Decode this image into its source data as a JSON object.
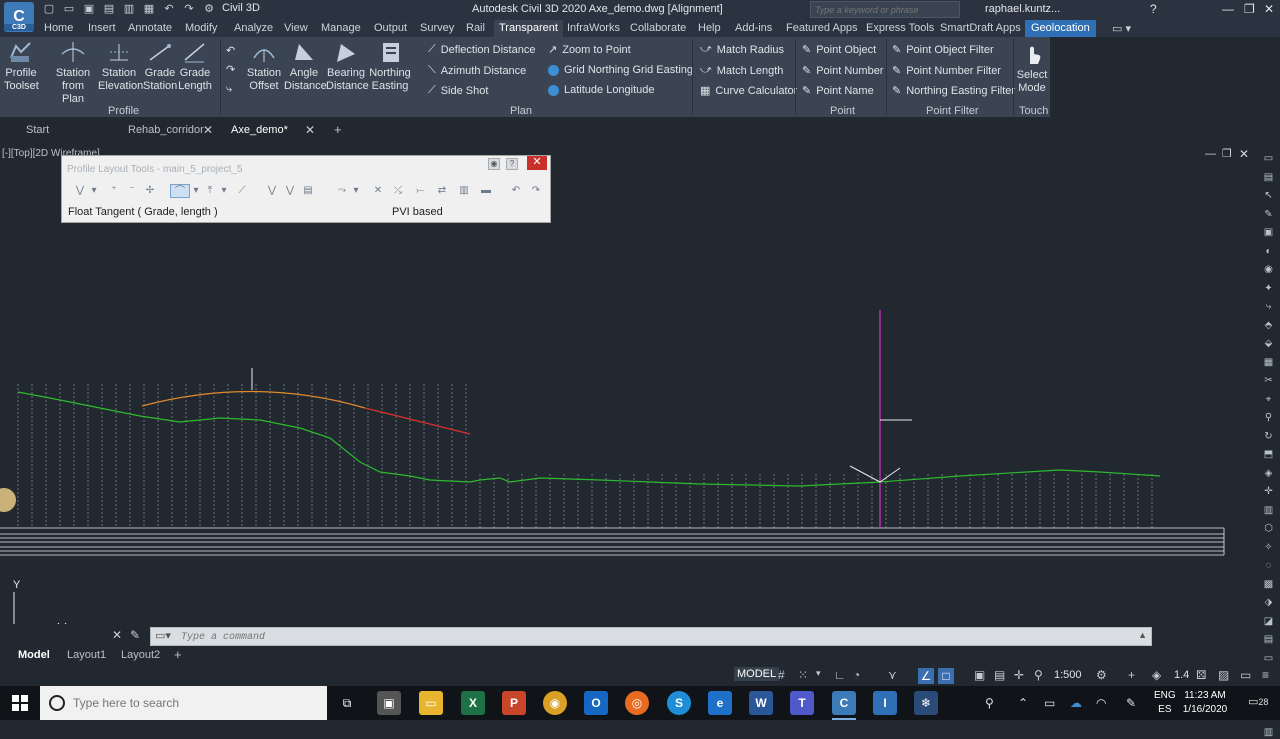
{
  "titlebar": {
    "workspace": "Civil 3D",
    "title": "Autodesk Civil 3D 2020   Axe_demo.dwg [Alignment]",
    "search_placeholder": "Type a keyword or phrase",
    "user": "raphael.kuntz...",
    "logo_text": "C",
    "logo_sub": "C3D"
  },
  "menu": [
    "Home",
    "Insert",
    "Annotate",
    "Modify",
    "Analyze",
    "View",
    "Manage",
    "Output",
    "Survey",
    "Rail",
    "Transparent",
    "InfraWorks",
    "Collaborate",
    "Help",
    "Add-ins",
    "Featured Apps",
    "Express Tools",
    "SmartDraft Apps",
    "Geolocation"
  ],
  "menu_active": "Transparent",
  "ribbon": {
    "profile_buttons": [
      {
        "l1": "Profile",
        "l2": "Toolset"
      },
      {
        "l1": "Station",
        "l2": "from Plan"
      },
      {
        "l1": "Station",
        "l2": "Elevation"
      },
      {
        "l1": "Grade",
        "l2": "Station"
      },
      {
        "l1": "Grade",
        "l2": "Length"
      }
    ],
    "plan_buttons": [
      {
        "l1": "Station",
        "l2": "Offset"
      },
      {
        "l1": "Angle",
        "l2": "Distance"
      },
      {
        "l1": "Bearing",
        "l2": "Distance"
      },
      {
        "l1": "Northing",
        "l2": "Easting"
      }
    ],
    "plan_small_a": [
      "Deflection Distance",
      "Azimuth Distance",
      "Side Shot"
    ],
    "plan_small_b": [
      "Zoom to Point",
      "Grid Northing Grid Easting",
      "Latitude Longitude"
    ],
    "curve_small": [
      "Match Radius",
      "Match Length",
      "Curve Calculator"
    ],
    "point_small": [
      "Point Object",
      "Point Number",
      "Point Name"
    ],
    "pointfilter_small": [
      "Point Object Filter",
      "Point Number Filter",
      "Northing Easting Filter"
    ],
    "touch_button": {
      "l1": "Select",
      "l2": "Mode"
    },
    "panels": {
      "profile": "Profile",
      "plan": "Plan",
      "point": "Point",
      "point_filter": "Point Filter",
      "touch": "Touch"
    }
  },
  "filetabs": [
    "Start",
    "Rehab_corridor",
    "Axe_demo*"
  ],
  "viewport_label": "[-][Top][2D Wireframe]",
  "plt": {
    "title": "Profile Layout Tools - main_5_project_5",
    "mode": "Float Tangent ( Grade, length )",
    "mode2": "PVI based"
  },
  "command": {
    "placeholder": "Type a command"
  },
  "layouts": [
    "Model",
    "Layout1",
    "Layout2"
  ],
  "status": {
    "model": "MODEL",
    "scale": "1:500",
    "lineweight": "1.4"
  },
  "ucs": {
    "y": "Y"
  },
  "taskbar": {
    "search_placeholder": "Type here to search",
    "lang1": "ENG",
    "lang2": "ES",
    "time": "11:23 AM",
    "date": "1/16/2020",
    "notif_count": "28"
  },
  "colors": {
    "ground": "#2dbb2d",
    "profile_curve": "#e08a2a",
    "profile_tangent": "#d9302c",
    "marker": "#d631c8",
    "accent": "#2e6fb5"
  }
}
